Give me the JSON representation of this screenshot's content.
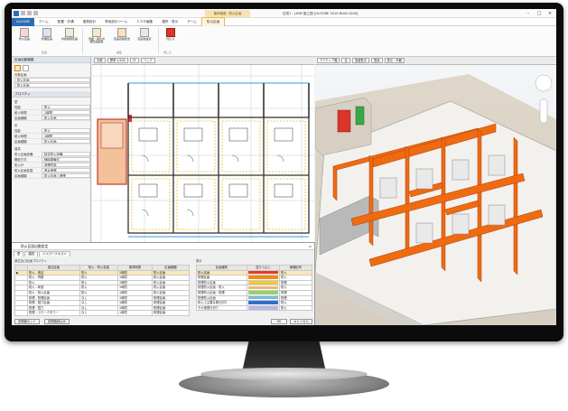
{
  "window": {
    "title": "住宅1 - J-BIM 施工図 [GLOOBE 2019 Build 1000]",
    "context_group": "躯体構造 : 防火区画"
  },
  "tabs": [
    "GLOOBE",
    "ホーム",
    "配置・外構",
    "建物設計",
    "専用設計ツール",
    "ＣＡＤ編集",
    "選択・表示",
    "チーム",
    "防火区画"
  ],
  "ribbon": {
    "buttons": [
      "防火区画",
      "防煙区画",
      "内装制限区画",
      "界壁・間仕切\n壁区画編集",
      "区画自動配置",
      "区画色設定",
      "閉じる"
    ],
    "groups": [
      "区画",
      "編集",
      "閉じる"
    ]
  },
  "left_panel": {
    "header": "区画自動編集",
    "target_label": "対象区画",
    "target_value": "防火区画",
    "target_value2": "防火区画",
    "props_header": "プロパティ",
    "section_wall": "壁",
    "rows_wall": [
      {
        "k": "性能",
        "v": "防火"
      },
      {
        "k": "耐火時間",
        "v": "1時間"
      },
      {
        "k": "区画種類",
        "v": "防火区画"
      }
    ],
    "section_floor": "床",
    "rows_floor": [
      {
        "k": "性能",
        "v": "防火"
      },
      {
        "k": "耐火時間",
        "v": "1時間"
      },
      {
        "k": "区画種類",
        "v": "防火区画"
      }
    ],
    "section_fitting": "建具",
    "rows_fitting": [
      {
        "k": "防火区画設備",
        "v": "特定防火設備"
      },
      {
        "k": "開放方式",
        "v": "随時閉鎖式"
      },
      {
        "k": "防火戸",
        "v": "遮煙性能"
      },
      {
        "k": "防火区画性能",
        "v": "遮炎遮煙"
      },
      {
        "k": "区画種類",
        "v": "防火区画 / 遮煙"
      }
    ]
  },
  "plan_toolbar": [
    "手動",
    "標準 1/100",
    "2F",
    "バック"
  ],
  "view3d_toolbar": [
    "アクティブ階",
    "全",
    "透過表示",
    "透過",
    "表示・外観"
  ],
  "dialog": {
    "title": "防火区画自動設定",
    "tabs": [
      "壁",
      "建具",
      "ハイパーテキスト"
    ],
    "left_caption": "部位及び区画プロパティ",
    "left_headers": [
      "部位区画",
      "防火・防火性能",
      "基準時間",
      "区画種類"
    ],
    "left_rows": [
      [
        "防火 - 風呂",
        "防火",
        "1時間",
        "防火区画"
      ],
      [
        "防火 - 界壁",
        "防火",
        "1時間",
        "防火区画"
      ],
      [
        "防火",
        "防火",
        "1時間",
        "防火区画"
      ],
      [
        "防火 - 和室",
        "防火",
        "1時間",
        "防火区画"
      ],
      [
        "防火 - 防火区画",
        "防火",
        "1時間",
        "防火区画"
      ],
      [
        "防煙 - 防煙区画",
        "なし",
        "1時間",
        "防煙区画"
      ],
      [
        "防煙 - 竪穴区画",
        "なし",
        "1時間",
        "防煙区画"
      ],
      [
        "防煙 - 竪穴",
        "なし",
        "1時間",
        "防煙区画"
      ],
      [
        "防煙 - スモークタワー",
        "なし",
        "1時間",
        "防煙区画"
      ]
    ],
    "right_caption": "表示",
    "right_headers": [
      "区画種別",
      "塗りつぶし",
      "線種記号"
    ],
    "right_rows": [
      {
        "name": "防火区画",
        "color": "#e03a2a",
        "line": "防火"
      },
      {
        "name": "防煙区画",
        "color": "#f08a1c",
        "line": "防火"
      },
      {
        "name": "防煙防火区画",
        "color": "#e9cc3a",
        "line": "防煙"
      },
      {
        "name": "防煙防火区画・防火",
        "color": "#f2b27a",
        "line": "防火"
      },
      {
        "name": "防煙防火区画・防煙",
        "color": "#8fd36f",
        "line": "防煙"
      },
      {
        "name": "防煙防火区画",
        "color": "#7bbbe0",
        "line": "防煙"
      },
      {
        "name": "防火上主要な間仕切り",
        "color": "#2f6fd0",
        "line": "防火"
      },
      {
        "name": "その他間仕切り",
        "color": "#b8b8e8",
        "line": "防火"
      }
    ],
    "btn_reset": "初期値セット",
    "btn_read": "初期値読込み",
    "btn_ok": "OK",
    "btn_cancel": "キャンセル"
  },
  "colors": {
    "fire_wall": "#f06a12",
    "accent": "#2d6cb5"
  }
}
